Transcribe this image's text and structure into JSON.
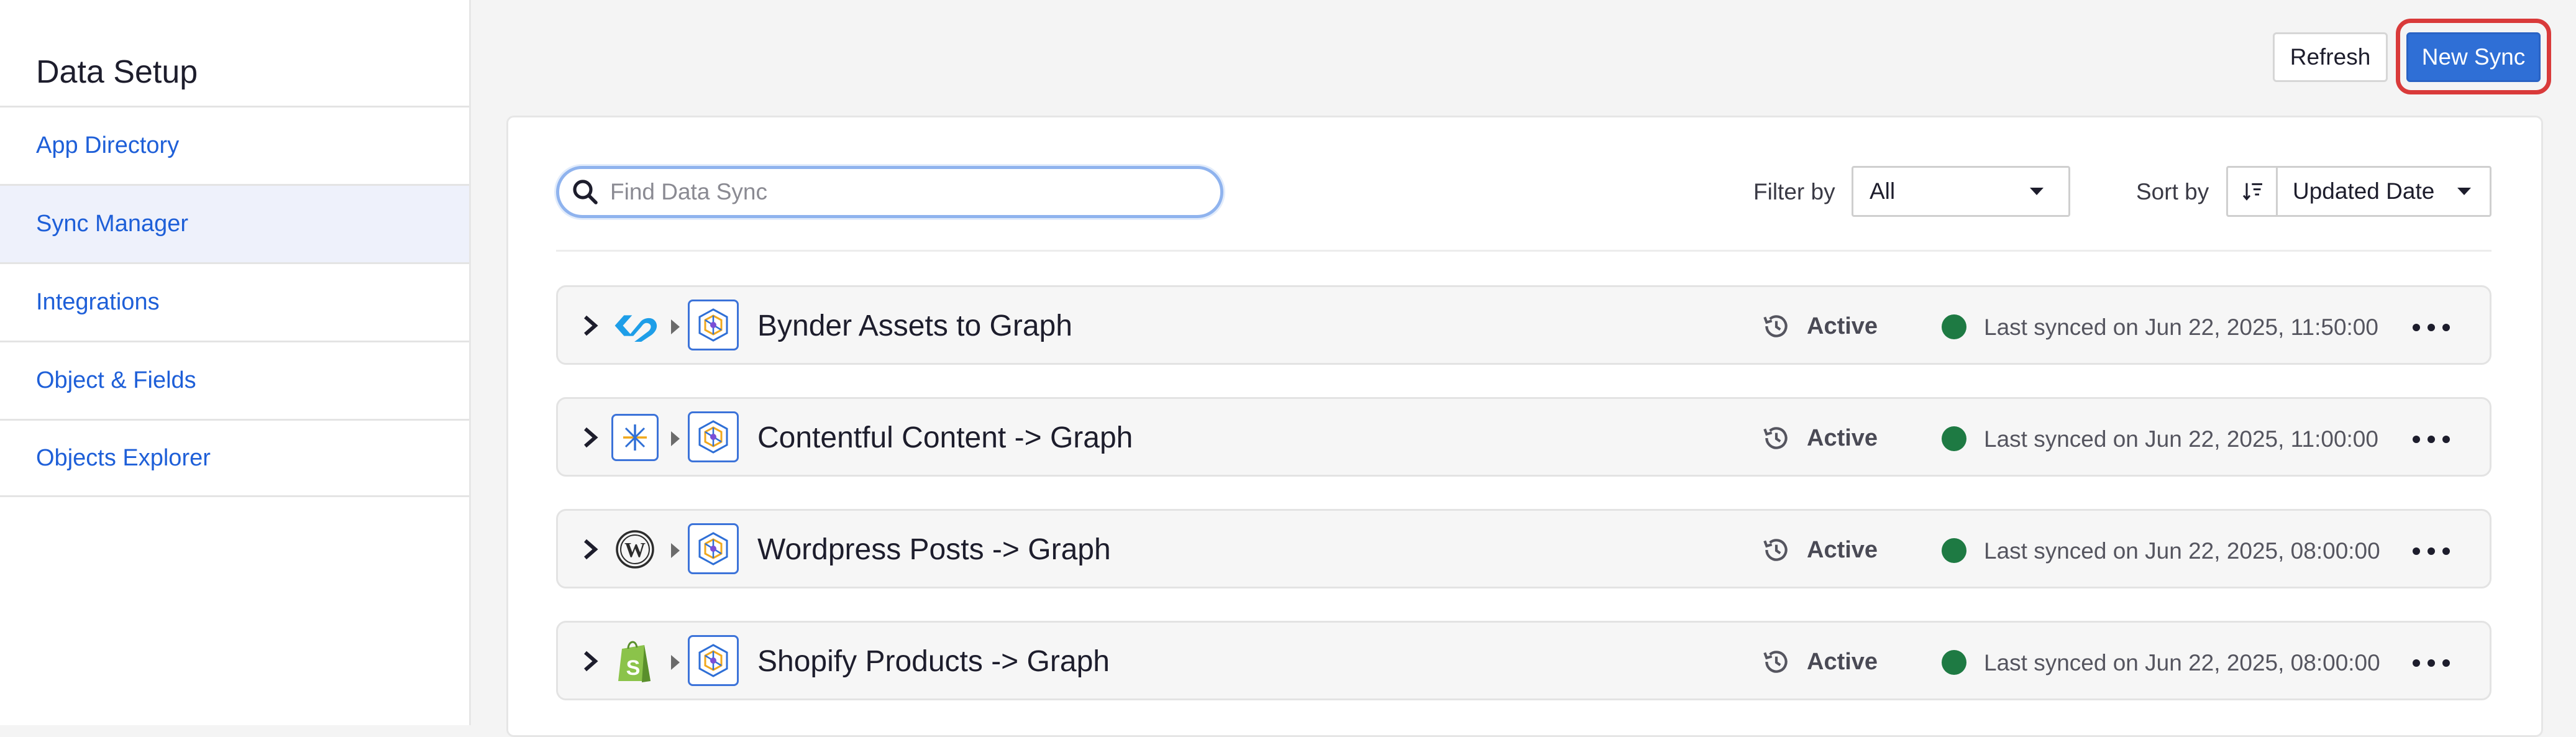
{
  "sidebar": {
    "title": "Data Setup",
    "items": [
      {
        "label": "App Directory"
      },
      {
        "label": "Sync Manager",
        "active": true
      },
      {
        "label": "Integrations"
      },
      {
        "label": "Object & Fields"
      },
      {
        "label": "Objects Explorer"
      }
    ]
  },
  "toolbar": {
    "refresh_label": "Refresh",
    "new_sync_label": "New Sync"
  },
  "search": {
    "placeholder": "Find Data Sync",
    "value": "",
    "icon": "search-icon"
  },
  "filter": {
    "label": "Filter by",
    "selected": "All"
  },
  "sort": {
    "label": "Sort by",
    "direction_icon": "sort-descending-icon",
    "selected": "Updated Date"
  },
  "syncs": [
    {
      "name": "Bynder Assets to Graph",
      "source_icon": "bynder-logo-icon",
      "destination_icon": "graph-logo-icon",
      "status": "Active",
      "last_synced": "Last synced on Jun 22, 2025, 11:50:00"
    },
    {
      "name": "Contentful Content -> Graph",
      "source_icon": "contentful-logo-icon",
      "destination_icon": "graph-logo-icon",
      "status": "Active",
      "last_synced": "Last synced on Jun 22, 2025, 11:00:00"
    },
    {
      "name": "Wordpress Posts -> Graph",
      "source_icon": "wordpress-logo-icon",
      "destination_icon": "graph-logo-icon",
      "status": "Active",
      "last_synced": "Last synced on Jun 22, 2025, 08:00:00"
    },
    {
      "name": "Shopify Products -> Graph",
      "source_icon": "shopify-logo-icon",
      "destination_icon": "graph-logo-icon",
      "status": "Active",
      "last_synced": "Last synced on Jun 22, 2025, 08:00:00"
    }
  ],
  "colors": {
    "primary": "#2f6fd6",
    "link": "#1e5fd8",
    "status_ok": "#1e7a43",
    "highlight": "#d93a3a",
    "active_nav_bg": "#eef1fb"
  }
}
